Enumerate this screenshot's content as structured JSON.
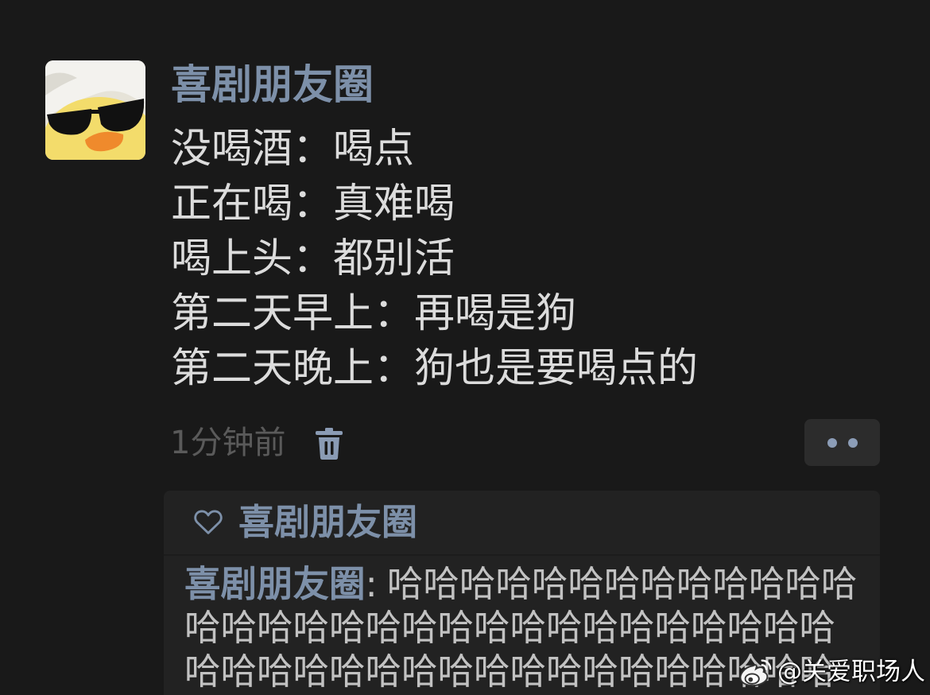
{
  "theme": {
    "background": "#191919",
    "panel_background": "#222222",
    "name_color": "#7d90a9",
    "text_color": "#dcdcdc",
    "muted_color": "#5a5a5a",
    "comment_color": "#c2c2c2"
  },
  "post": {
    "avatar_icon": "duck-with-sunglasses-avatar",
    "author": "喜剧朋友圈",
    "lines": [
      "没喝酒：喝点",
      "正在喝：真难喝",
      "喝上头：都别活",
      "第二天早上：再喝是狗",
      "第二天晚上：狗也是要喝点的"
    ],
    "timestamp": "1分钟前",
    "delete_icon": "trash-icon",
    "more_icon": "more-dots-icon"
  },
  "interactions": {
    "like_icon": "heart-icon",
    "likes": [
      "喜剧朋友圈"
    ],
    "comments": [
      {
        "author": "喜剧朋友圈",
        "separator": ":",
        "lines": [
          "哈哈哈哈哈哈哈哈哈哈哈哈哈",
          "哈哈哈哈哈哈哈哈哈哈哈哈哈哈哈哈哈哈",
          "哈哈哈哈哈哈哈哈哈哈哈哈哈哈哈哈哈哈"
        ]
      }
    ]
  },
  "watermark": {
    "logo_icon": "weibo-logo-icon",
    "text": "@关爱职场人"
  }
}
